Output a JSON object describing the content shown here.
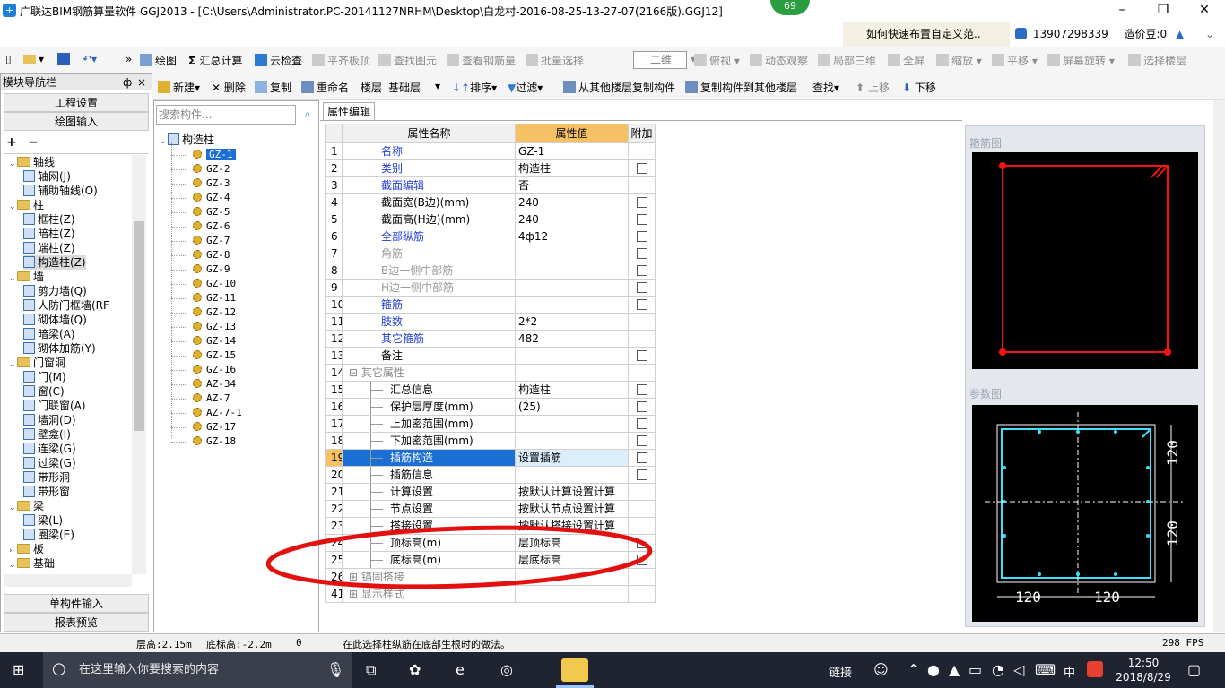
{
  "window": {
    "title": "广联达BIM钢筋算量软件 GGJ2013 - [C:\\Users\\Administrator.PC-20141127NRHM\\Desktop\\白龙村-2016-08-25-13-27-07(2166版).GGJ12]",
    "badge": "69",
    "help_link": "如何快速布置自定义范..",
    "user": "13907298339",
    "price_label": "造价豆:0"
  },
  "toolbar1": {
    "draw": "绘图",
    "summary": "汇总计算",
    "cloud_check": "云检查",
    "flat_board": "平齐板顶",
    "find_elem": "查找图元",
    "view_rebar": "查看钢筋量",
    "batch_select": "批量选择",
    "view_mode": "二维",
    "top_view": "俯视",
    "dynamic": "动态观察",
    "local3d": "局部三维",
    "fullscreen": "全屏",
    "zoom": "缩放",
    "pan": "平移",
    "rotate": "屏幕旋转",
    "select_floor": "选择楼层"
  },
  "toolbar2": {
    "new": "新建",
    "delete": "删除",
    "copy": "复制",
    "rename": "重命名",
    "floor_label": "楼层",
    "floor_value": "基础层",
    "sort": "排序",
    "filter": "过滤",
    "copy_from": "从其他楼层复制构件",
    "copy_to": "复制构件到其他楼层",
    "find": "查找",
    "move_up": "上移",
    "move_down": "下移"
  },
  "nav": {
    "header": "模块导航栏",
    "pin": "ф",
    "close": "×",
    "btn_project": "工程设置",
    "btn_draw": "绘图输入",
    "btn_single": "单构件输入",
    "btn_report": "报表预览",
    "tree": [
      {
        "label": "轴线",
        "level": 0,
        "folder": true,
        "exp": "⌄"
      },
      {
        "label": "轴网(J)",
        "level": 1
      },
      {
        "label": "辅助轴线(O)",
        "level": 1
      },
      {
        "label": "柱",
        "level": 0,
        "folder": true,
        "exp": "⌄"
      },
      {
        "label": "框柱(Z)",
        "level": 1
      },
      {
        "label": "暗柱(Z)",
        "level": 1
      },
      {
        "label": "端柱(Z)",
        "level": 1
      },
      {
        "label": "构造柱(Z)",
        "level": 1,
        "selected": true
      },
      {
        "label": "墙",
        "level": 0,
        "folder": true,
        "exp": "⌄"
      },
      {
        "label": "剪力墙(Q)",
        "level": 1
      },
      {
        "label": "人防门框墙(RF",
        "level": 1
      },
      {
        "label": "砌体墙(Q)",
        "level": 1
      },
      {
        "label": "暗梁(A)",
        "level": 1
      },
      {
        "label": "砌体加筋(Y)",
        "level": 1
      },
      {
        "label": "门窗洞",
        "level": 0,
        "folder": true,
        "exp": "⌄"
      },
      {
        "label": "门(M)",
        "level": 1
      },
      {
        "label": "窗(C)",
        "level": 1
      },
      {
        "label": "门联窗(A)",
        "level": 1
      },
      {
        "label": "墙洞(D)",
        "level": 1
      },
      {
        "label": "壁龛(I)",
        "level": 1
      },
      {
        "label": "连梁(G)",
        "level": 1
      },
      {
        "label": "过梁(G)",
        "level": 1
      },
      {
        "label": "带形洞",
        "level": 1
      },
      {
        "label": "带形窗",
        "level": 1
      },
      {
        "label": "梁",
        "level": 0,
        "folder": true,
        "exp": "⌄"
      },
      {
        "label": "梁(L)",
        "level": 1
      },
      {
        "label": "圈梁(E)",
        "level": 1
      },
      {
        "label": "板",
        "level": 0,
        "folder": true,
        "exp": "›"
      },
      {
        "label": "基础",
        "level": 0,
        "folder": true,
        "exp": "⌄"
      }
    ]
  },
  "components": {
    "search_placeholder": "搜索构件...",
    "root": "构造柱",
    "items": [
      "GZ-1",
      "GZ-2",
      "GZ-3",
      "GZ-4",
      "GZ-5",
      "GZ-6",
      "GZ-7",
      "GZ-8",
      "GZ-9",
      "GZ-10",
      "GZ-11",
      "GZ-12",
      "GZ-13",
      "GZ-14",
      "GZ-15",
      "GZ-16",
      "AZ-34",
      "AZ-7",
      "AZ-7-1",
      "GZ-17",
      "GZ-18"
    ]
  },
  "props": {
    "tab": "属性编辑",
    "col_name": "属性名称",
    "col_value": "属性值",
    "col_extra": "附加",
    "rows": [
      {
        "n": "1",
        "name": "名称",
        "value": "GZ-1",
        "style": "blue",
        "cb": false
      },
      {
        "n": "2",
        "name": "类别",
        "value": "构造柱",
        "style": "blue",
        "cb": true
      },
      {
        "n": "3",
        "name": "截面编辑",
        "value": "否",
        "style": "blue",
        "cb": false
      },
      {
        "n": "4",
        "name": "截面宽(B边)(mm)",
        "value": "240",
        "style": "",
        "cb": true
      },
      {
        "n": "5",
        "name": "截面高(H边)(mm)",
        "value": "240",
        "style": "",
        "cb": true
      },
      {
        "n": "6",
        "name": "全部纵筋",
        "value": "4ф12",
        "style": "blue",
        "cb": true
      },
      {
        "n": "7",
        "name": "角筋",
        "value": "",
        "style": "gray",
        "cb": true
      },
      {
        "n": "8",
        "name": "B边一侧中部筋",
        "value": "",
        "style": "gray",
        "cb": true
      },
      {
        "n": "9",
        "name": "H边一侧中部筋",
        "value": "",
        "style": "gray",
        "cb": true
      },
      {
        "n": "10",
        "name": "箍筋",
        "value": "",
        "style": "blue",
        "cb": true
      },
      {
        "n": "11",
        "name": "肢数",
        "value": "2*2",
        "style": "blue",
        "cb": false
      },
      {
        "n": "12",
        "name": "其它箍筋",
        "value": "482",
        "style": "blue",
        "cb": false
      },
      {
        "n": "13",
        "name": "备注",
        "value": "",
        "style": "",
        "cb": true
      },
      {
        "n": "14",
        "name": "其它属性",
        "value": "",
        "style": "group",
        "cb": false
      },
      {
        "n": "15",
        "name": "汇总信息",
        "value": "构造柱",
        "style": "sub",
        "cb": true
      },
      {
        "n": "16",
        "name": "保护层厚度(mm)",
        "value": "(25)",
        "style": "sub",
        "cb": true
      },
      {
        "n": "17",
        "name": "上加密范围(mm)",
        "value": "",
        "style": "sub",
        "cb": true
      },
      {
        "n": "18",
        "name": "下加密范围(mm)",
        "value": "",
        "style": "sub",
        "cb": true
      },
      {
        "n": "19",
        "name": "插筋构造",
        "value": "设置插筋",
        "style": "selected",
        "cb": true
      },
      {
        "n": "20",
        "name": "插筋信息",
        "value": "",
        "style": "sub",
        "cb": true
      },
      {
        "n": "21",
        "name": "计算设置",
        "value": "按默认计算设置计算",
        "style": "sub",
        "cb": false
      },
      {
        "n": "22",
        "name": "节点设置",
        "value": "按默认节点设置计算",
        "style": "sub",
        "cb": false
      },
      {
        "n": "23",
        "name": "搭接设置",
        "value": "按默认搭接设置计算",
        "style": "sub",
        "cb": false
      },
      {
        "n": "24",
        "name": "顶标高(m)",
        "value": "层顶标高",
        "style": "sub",
        "cb": true
      },
      {
        "n": "25",
        "name": "底标高(m)",
        "value": "层底标高",
        "style": "sub",
        "cb": true
      },
      {
        "n": "26",
        "name": "锚固搭接",
        "value": "",
        "style": "group",
        "cb": false
      },
      {
        "n": "41",
        "name": "显示样式",
        "value": "",
        "style": "group",
        "cb": false
      }
    ]
  },
  "right": {
    "stirrup_title": "箍筋图",
    "param_title": "参数图",
    "dim_120": "120"
  },
  "status": {
    "floor_height": "层高:2.15m",
    "bottom_elev": "底标高:-2.2m",
    "zero": "0",
    "hint": "在此选择柱纵筋在底部生根时的做法。",
    "fps": "298 FPS"
  },
  "taskbar": {
    "search_placeholder": "在这里输入你要搜索的内容",
    "link": "链接",
    "ime": "中",
    "time": "12:50",
    "date": "2018/8/29"
  },
  "colors": {
    "selection_blue": "#1a6ed4",
    "highlight_header": "#f6c064",
    "annotation_red": "#e31010",
    "cad_red": "#ff1010",
    "cad_cyan": "#3fe0ff"
  }
}
